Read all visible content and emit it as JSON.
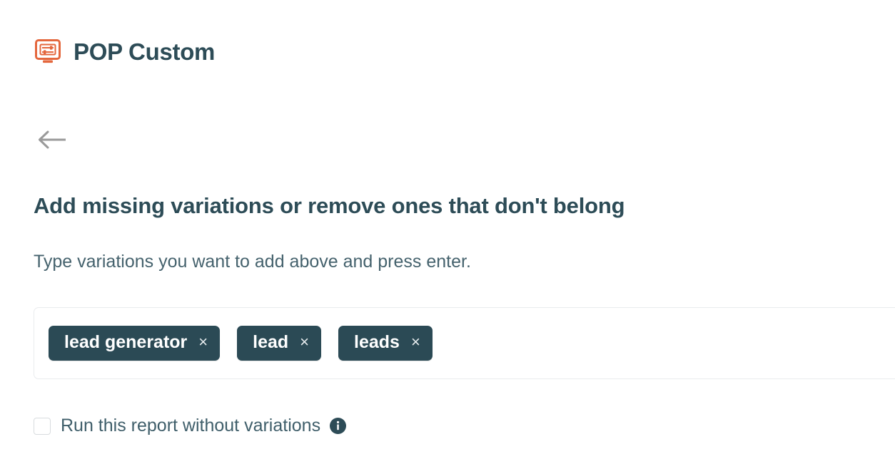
{
  "app": {
    "title": "POP Custom",
    "logo_icon": "monitor-sliders-icon",
    "logo_color": "#e4673d",
    "title_color": "#2d4c57"
  },
  "navigation": {
    "back_icon": "arrow-left-icon",
    "back_color": "#9a9a9a"
  },
  "section": {
    "heading": "Add missing variations or remove ones that don't belong",
    "subtitle": "Type variations you want to add above and press enter."
  },
  "tag_input": {
    "chip_bg": "#2b4a55",
    "chip_text_color": "#ffffff",
    "remove_icon": "close-icon",
    "remove_glyph": "×",
    "tags": [
      {
        "label": "lead generator"
      },
      {
        "label": "lead"
      },
      {
        "label": "leads"
      }
    ]
  },
  "options": {
    "run_without_variations": {
      "label": "Run this report without variations",
      "checked": false,
      "info_icon": "info-icon",
      "info_glyph": "i"
    }
  }
}
